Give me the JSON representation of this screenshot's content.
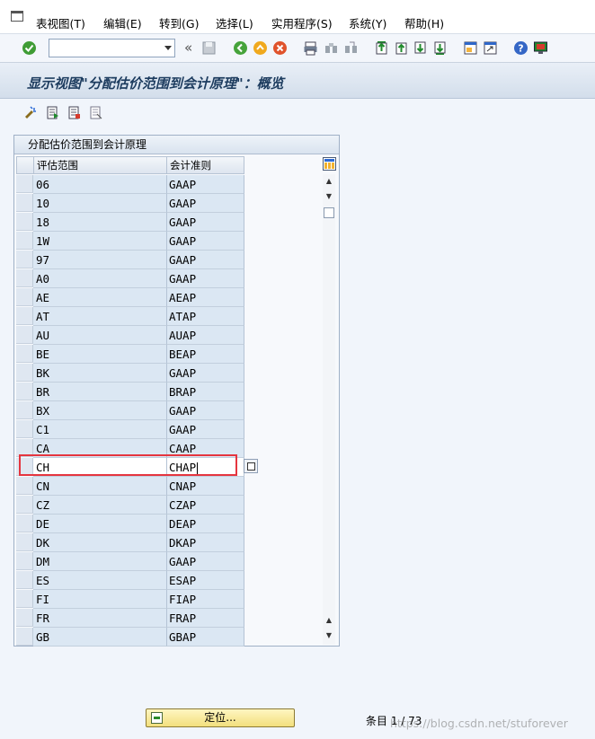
{
  "menu": [
    "表视图(T)",
    "编辑(E)",
    "转到(G)",
    "选择(L)",
    "实用程序(S)",
    "系统(Y)",
    "帮助(H)"
  ],
  "toolbar": {
    "command_value": "",
    "double_arrow": "«"
  },
  "title": "显示视图\"分配估价范围到会计原理\"：概览",
  "table": {
    "title": "分配估价范围到会计原理",
    "columns": [
      "评估范围",
      "会计准则"
    ],
    "rows": [
      [
        "06",
        "GAAP"
      ],
      [
        "10",
        "GAAP"
      ],
      [
        "18",
        "GAAP"
      ],
      [
        "1W",
        "GAAP"
      ],
      [
        "97",
        "GAAP"
      ],
      [
        "A0",
        "GAAP"
      ],
      [
        "AE",
        "AEAP"
      ],
      [
        "AT",
        "ATAP"
      ],
      [
        "AU",
        "AUAP"
      ],
      [
        "BE",
        "BEAP"
      ],
      [
        "BK",
        "GAAP"
      ],
      [
        "BR",
        "BRAP"
      ],
      [
        "BX",
        "GAAP"
      ],
      [
        "C1",
        "GAAP"
      ],
      [
        "CA",
        "CAAP"
      ],
      [
        "CH",
        "CHAP"
      ],
      [
        "CN",
        "CNAP"
      ],
      [
        "CZ",
        "CZAP"
      ],
      [
        "DE",
        "DEAP"
      ],
      [
        "DK",
        "DKAP"
      ],
      [
        "DM",
        "GAAP"
      ],
      [
        "ES",
        "ESAP"
      ],
      [
        "FI",
        "FIAP"
      ],
      [
        "FR",
        "FRAP"
      ],
      [
        "GB",
        "GBAP"
      ]
    ],
    "active_row_index": 15
  },
  "position_button": "定位...",
  "entry_info": "条目 1 / 73",
  "watermark": "https://blog.csdn.net/stuforever",
  "colors": {
    "highlight": "#e5353f",
    "title_text": "#1d3c5f"
  }
}
